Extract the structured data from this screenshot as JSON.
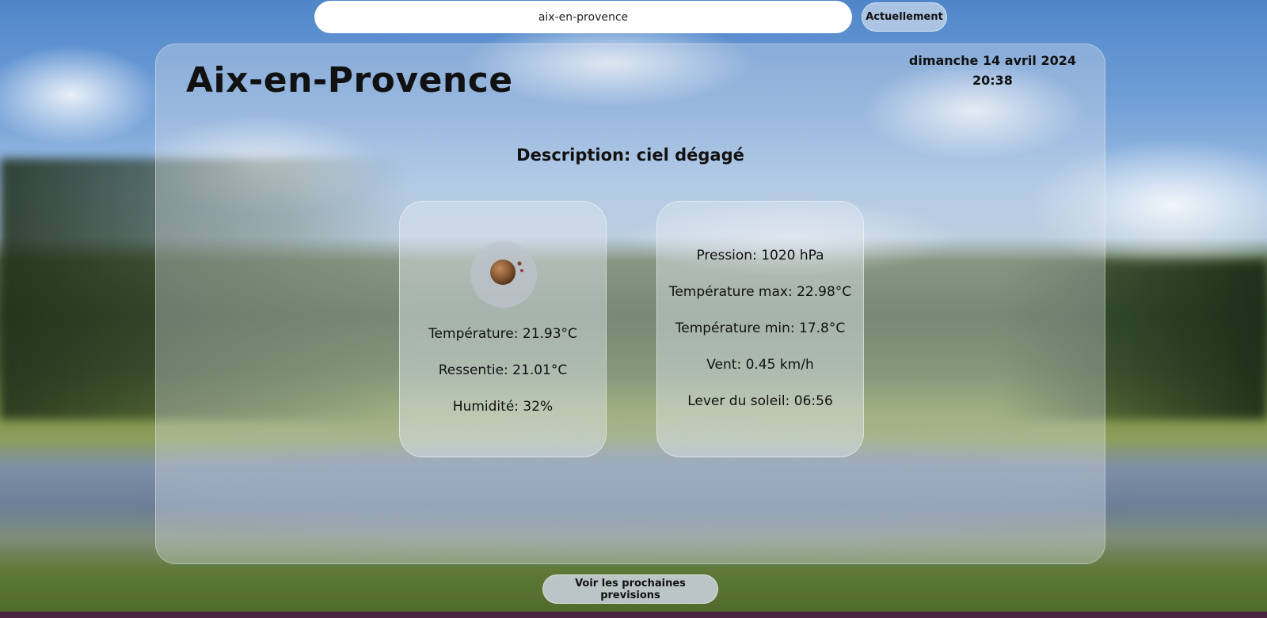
{
  "search": {
    "value": "aix-en-provence"
  },
  "now_button": {
    "label": "Actuellement"
  },
  "weather": {
    "city": "Aix-en-Provence",
    "date": "dimanche 14 avril 2024",
    "time": "20:38",
    "description": "Description: ciel dégagé",
    "icon": "clear-night-moon-icon",
    "left_card": {
      "temperature": "Température: 21.93°C",
      "feels_like": "Ressentie: 21.01°C",
      "humidity": "Humidité: 32%"
    },
    "right_card": {
      "pressure": "Pression: 1020 hPa",
      "temp_max": "Température max: 22.98°C",
      "temp_min": "Température min: 17.8°C",
      "wind": "Vent: 0.45 km/h",
      "sunrise": "Lever du soleil: 06:56"
    }
  },
  "forecast_button": {
    "label": "Voir les prochaines previsions"
  },
  "colors": {
    "card_glass": "#dfe3ea",
    "text": "#111111",
    "moon": "#8a5a35",
    "bottom_bar": "#4a2340"
  }
}
